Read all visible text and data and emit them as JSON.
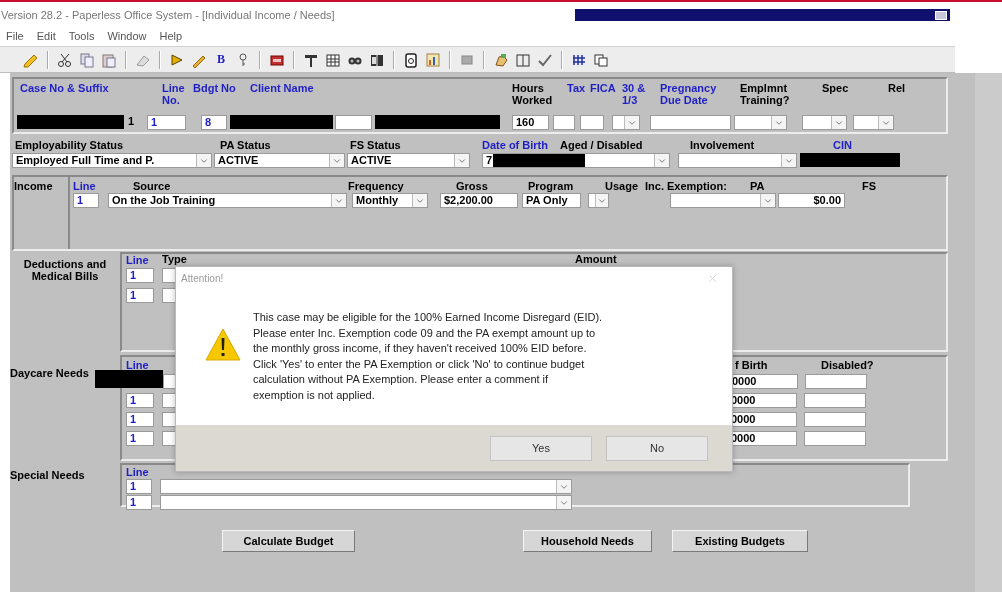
{
  "window": {
    "title": "Version 28.2 - Paperless Office System - [Individual Income / Needs]"
  },
  "menu": [
    "File",
    "Edit",
    "Tools",
    "Window",
    "Help"
  ],
  "toolbar": {
    "bold_button": "B"
  },
  "case": {
    "headers": [
      {
        "text": "Case No & Suffix",
        "color": "#1f1fc8"
      },
      {
        "text": "Line No.",
        "color": "#1f1fc8"
      },
      {
        "text": "Bdgt No",
        "color": "#1f1fc8"
      },
      {
        "text": "Client Name",
        "color": "#1f1fc8"
      },
      {
        "text": "Hours Worked",
        "color": "#000000"
      },
      {
        "text": "Tax",
        "color": "#1f1fc8"
      },
      {
        "text": "FICA",
        "color": "#1f1fc8"
      },
      {
        "text": "30 & 1/3",
        "color": "#1f1fc8"
      },
      {
        "text": "Pregnancy Due Date",
        "color": "#1f1fc8"
      },
      {
        "text": "Emplmnt Training?",
        "color": "#000000"
      },
      {
        "text": "Spec",
        "color": "#000000"
      },
      {
        "text": "Rel",
        "color": "#000000"
      }
    ],
    "fields": [
      {
        "kind": "redacted"
      },
      {
        "kind": "plain",
        "value": "1"
      },
      {
        "kind": "line",
        "value": "1"
      },
      {
        "kind": "line",
        "value": "8"
      },
      {
        "kind": "redacted"
      },
      {
        "kind": "text"
      },
      {
        "kind": "redacted"
      },
      {
        "kind": "text",
        "value": "160"
      },
      {
        "kind": "text"
      },
      {
        "kind": "text"
      },
      {
        "kind": "dropdown"
      },
      {
        "kind": "text"
      },
      {
        "kind": "dropdown"
      },
      {
        "kind": "dropdown"
      },
      {
        "kind": "dropdown"
      }
    ]
  },
  "status": {
    "headers": [
      {
        "text": "Employability Status",
        "color": "#000000"
      },
      {
        "text": "PA Status",
        "color": "#000000"
      },
      {
        "text": "FS Status",
        "color": "#000000"
      },
      {
        "text": "Date of Birth",
        "color": "#1f1fc8"
      },
      {
        "text": "Aged / Disabled",
        "color": "#000000"
      },
      {
        "text": "Involvement",
        "color": "#000000"
      },
      {
        "text": "CIN",
        "color": "#1f1fc8"
      }
    ],
    "fields": [
      {
        "kind": "dropdown",
        "value": "Employed Full Time and P."
      },
      {
        "kind": "dropdown",
        "value": "ACTIVE"
      },
      {
        "kind": "dropdown",
        "value": "ACTIVE"
      },
      {
        "kind": "dropdown",
        "value": "7",
        "redacted": true
      },
      {
        "kind": "dropdown"
      },
      {
        "kind": "redacted"
      }
    ]
  },
  "income": {
    "label": "Income",
    "headers": [
      {
        "text": "Line",
        "color": "#1f1fc8"
      },
      {
        "text": "Source",
        "color": "#000000"
      },
      {
        "text": "Frequency",
        "color": "#000000"
      },
      {
        "text": "Gross",
        "color": "#000000"
      },
      {
        "text": "Program",
        "color": "#000000"
      },
      {
        "text": "Usage",
        "color": "#000000"
      },
      {
        "text": "Inc. Exemption:",
        "color": "#000000"
      },
      {
        "text": "PA",
        "color": "#000000"
      },
      {
        "text": "FS",
        "color": "#000000"
      }
    ],
    "fields": [
      {
        "kind": "line",
        "value": "1"
      },
      {
        "kind": "dropdown",
        "value": "On the Job Training"
      },
      {
        "kind": "dropdown",
        "value": "Monthly"
      },
      {
        "kind": "text",
        "value": "$2,200.00"
      },
      {
        "kind": "text",
        "value": "PA Only"
      },
      {
        "kind": "dropdown"
      },
      {
        "kind": "dropdown"
      },
      {
        "kind": "amount",
        "value": "$0.00"
      }
    ]
  },
  "deductions": {
    "label": "Deductions and Medical Bills",
    "headers": {
      "line": "Line",
      "type": "Type",
      "amount": "Amount"
    },
    "rows": [
      {
        "line": "1"
      },
      {
        "line": "1"
      }
    ]
  },
  "daycare": {
    "label": "Daycare Needs",
    "headers": {
      "line": "Line",
      "birth": "f Birth",
      "disabled": "Disabled?"
    },
    "rows": [
      {
        "redacted": true,
        "birth": "0000"
      },
      {
        "redacted": false,
        "line": "1",
        "birth": "0000"
      },
      {
        "redacted": false,
        "line": "1",
        "birth": "0000"
      },
      {
        "redacted": false,
        "line": "1",
        "birth": "0000"
      }
    ]
  },
  "special": {
    "label": "Special Needs",
    "headers": {
      "line": "Line"
    },
    "rows": [
      {
        "line": "1"
      },
      {
        "line": "1"
      }
    ]
  },
  "buttons": [
    "Calculate Budget",
    "Household Needs",
    "Existing Budgets"
  ],
  "dialog": {
    "title": "Attention!",
    "message": [
      "This case may be eligible for the 100% Earned Income Disregard (EID).",
      "Please enter Inc. Exemption code 09 and the PA exempt amount up to",
      "the monthly gross income, if they haven't received 100% EID before.",
      "Click 'Yes' to enter the PA Exemption or click 'No' to continue budget",
      "calculation without PA Exemption. Please enter a comment if",
      "exemption is not applied."
    ],
    "buttons": [
      "Yes",
      "No"
    ]
  }
}
